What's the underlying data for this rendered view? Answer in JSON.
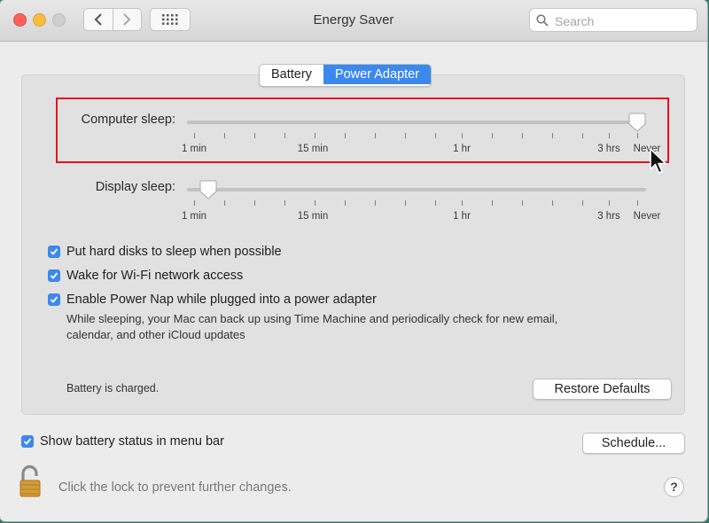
{
  "window": {
    "title": "Energy Saver"
  },
  "toolbar": {
    "search_placeholder": "Search"
  },
  "tabs": [
    {
      "label": "Battery",
      "active": false
    },
    {
      "label": "Power Adapter",
      "active": true
    }
  ],
  "sliders": {
    "computer_sleep": {
      "label": "Computer sleep:",
      "value": "Never"
    },
    "display_sleep": {
      "label": "Display sleep:",
      "value": "1 min"
    },
    "tick_labels": [
      "1 min",
      "15 min",
      "1 hr",
      "3 hrs",
      "Never"
    ]
  },
  "options": {
    "hard_disks": {
      "label": "Put hard disks to sleep when possible",
      "checked": true
    },
    "wifi": {
      "label": "Wake for Wi-Fi network access",
      "checked": true
    },
    "power_nap": {
      "label": "Enable Power Nap while plugged into a power adapter",
      "checked": true
    },
    "power_nap_desc_line1": "While sleeping, your Mac can back up using Time Machine and periodically check for new email,",
    "power_nap_desc_line2": "calendar, and other iCloud updates"
  },
  "status": "Battery is charged.",
  "buttons": {
    "restore_defaults": "Restore Defaults",
    "schedule": "Schedule..."
  },
  "footer": {
    "show_battery": {
      "label": "Show battery status in menu bar",
      "checked": true
    },
    "lock_text": "Click the lock to prevent further changes.",
    "help": "?"
  },
  "colors": {
    "accent": "#3b89ec",
    "highlight": "#e4121b"
  }
}
